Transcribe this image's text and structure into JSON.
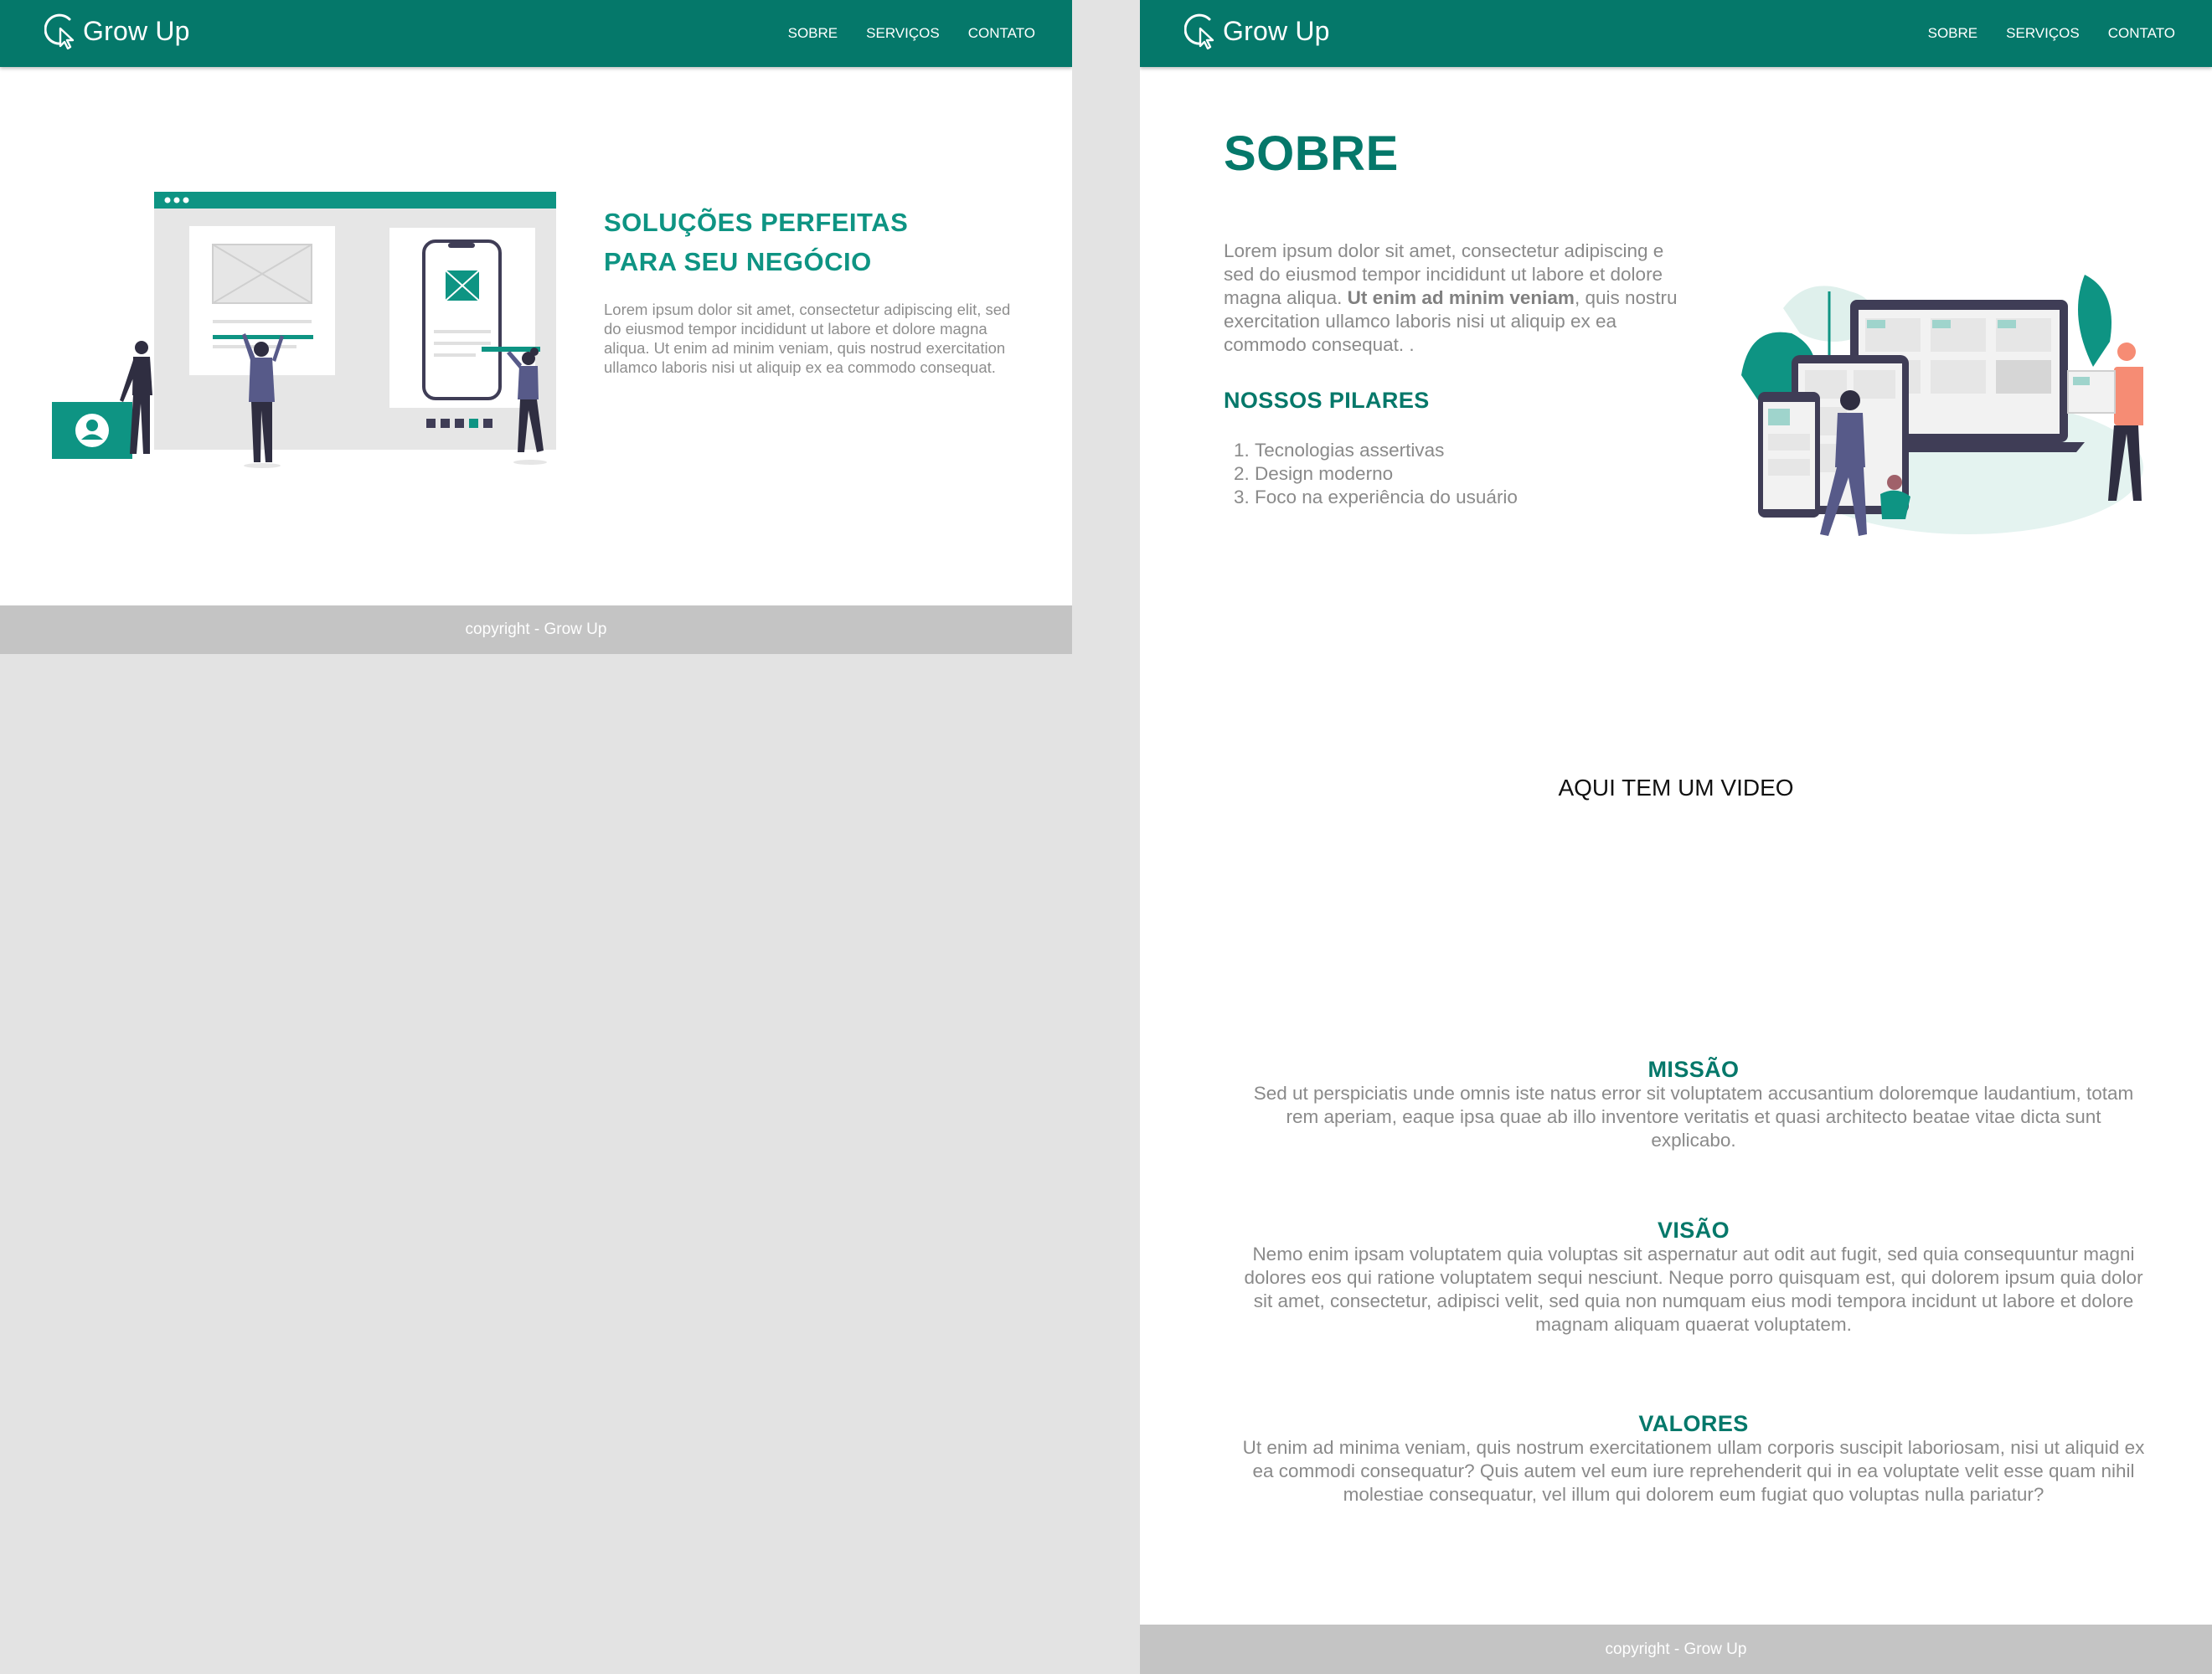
{
  "brand": {
    "name": "Grow Up",
    "icon": "cursor-click-icon",
    "color": "#05786a"
  },
  "nav": {
    "items": [
      "SOBRE",
      "SERVIÇOS",
      "CONTATO"
    ]
  },
  "footer": {
    "text": "copyright - Grow Up"
  },
  "home": {
    "hero": {
      "title_line1": "SOLUÇÕES PERFEITAS",
      "title_line2": "PARA SEU NEGÓCIO",
      "text": "Lorem ipsum dolor sit amet, consectetur adipiscing elit, sed do eiusmod tempor incididunt ut labore et dolore magna aliqua. Ut enim ad minim veniam, quis nostrud exercitation ullamco laboris nisi ut aliquip ex ea commodo consequat."
    }
  },
  "about": {
    "title": "SOBRE",
    "intro": {
      "line1": "Lorem ipsum dolor sit amet, consectetur adipiscing e",
      "line2": "sed do eiusmod tempor incididunt ut labore et dolore",
      "line3_before": "magna aliqua. ",
      "line3_bold": "Ut enim ad minim veniam",
      "line3_after": ", quis nostru",
      "line4": "exercitation ullamco laboris nisi ut aliquip ex ea",
      "line5": "commodo consequat. ."
    },
    "pillars": {
      "title": "NOSSOS PILARES",
      "items": [
        "Tecnologias assertivas",
        "Design moderno",
        "Foco na experiência do usuário"
      ]
    },
    "video_label": "AQUI TEM UM VIDEO",
    "missao": {
      "title": "MISSÃO",
      "text": "Sed ut perspiciatis unde omnis iste natus error sit voluptatem accusantium doloremque laudantium, totam rem aperiam, eaque ipsa quae ab illo inventore veritatis et quasi architecto beatae vitae dicta sunt explicabo."
    },
    "visao": {
      "title": "VISÃO",
      "text": "Nemo enim ipsam voluptatem quia voluptas sit aspernatur aut odit aut fugit, sed quia consequuntur magni dolores eos qui ratione voluptatem sequi nesciunt. Neque porro quisquam est, qui dolorem ipsum quia dolor sit amet, consectetur, adipisci velit, sed quia non numquam eius modi tempora incidunt ut labore et dolore magnam aliquam quaerat voluptatem."
    },
    "valores": {
      "title": "VALORES",
      "text": "Ut enim ad minima veniam, quis nostrum exercitationem ullam corporis suscipit laboriosam, nisi ut aliquid ex ea commodi consequatur? Quis autem vel eum iure reprehenderit qui in ea voluptate velit esse quam nihil molestiae consequatur, vel illum qui dolorem eum fugiat quo voluptas nulla pariatur?"
    }
  },
  "colors": {
    "primary": "#05786a",
    "accent": "#0e9483",
    "footer": "#c4c4c4",
    "backdrop": "#e3e3e3"
  }
}
